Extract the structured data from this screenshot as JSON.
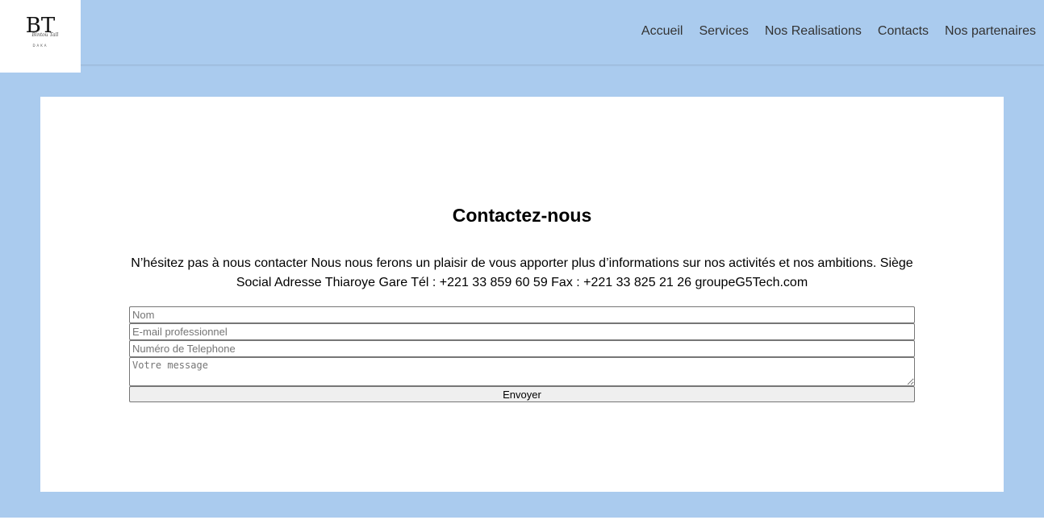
{
  "header": {
    "logo": {
      "monogram": "BT",
      "script": "Bintou Tall",
      "tagline": "DAKA"
    },
    "nav": [
      {
        "label": "Accueil"
      },
      {
        "label": "Services"
      },
      {
        "label": "Nos Realisations"
      },
      {
        "label": "Contacts"
      },
      {
        "label": "Nos partenaires"
      }
    ]
  },
  "contact": {
    "title": "Contactez-nous",
    "description": "N’hésitez pas à nous contacter Nous nous ferons un plaisir de vous apporter plus d’informations sur nos activités et nos ambitions. Siège Social Adresse Thiaroye Gare Tél : +221 33 859 60 59 Fax : +221 33 825 21 26 groupeG5Tech.com",
    "form": {
      "name_placeholder": "Nom",
      "email_placeholder": "E-mail professionnel",
      "phone_placeholder": "Numéro de Telephone",
      "message_placeholder": "Votre message",
      "submit_label": "Envoyer"
    }
  },
  "colors": {
    "background": "#aacbee",
    "card": "#ffffff",
    "nav_text": "#333333"
  }
}
